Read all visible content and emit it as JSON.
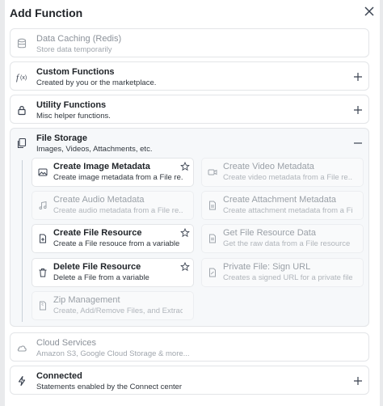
{
  "dialog": {
    "title": "Add Function",
    "close_icon": "close-icon"
  },
  "categories": [
    {
      "name": "Data Caching (Redis)",
      "desc": "Store data temporarily",
      "icon": "database-icon",
      "disabled": true
    },
    {
      "name": "Custom Functions",
      "desc": "Created by you or the marketplace.",
      "icon": "function-icon",
      "action": "plus-icon"
    },
    {
      "name": "Utility Functions",
      "desc": "Misc helper functions.",
      "icon": "lock-icon",
      "action": "plus-icon"
    },
    {
      "name": "File Storage",
      "desc": "Images, Videos, Attachments, etc.",
      "icon": "files-icon",
      "action": "minus-icon",
      "expanded": true
    },
    {
      "name": "Cloud Services",
      "desc": "Amazon S3, Google Cloud Storage & more...",
      "icon": "cloud-icon",
      "disabled": true
    },
    {
      "name": "Connected",
      "desc": "Statements enabled by the Connect center",
      "icon": "bolt-icon",
      "action": "plus-icon"
    }
  ],
  "file_storage_items": [
    {
      "name": "Create Image Metadata",
      "desc": "Create image metadata from a File re...",
      "icon": "image-icon",
      "enabled": true,
      "star": true
    },
    {
      "name": "Create Video Metadata",
      "desc": "Create video metadata from a File re...",
      "icon": "video-icon",
      "enabled": false
    },
    {
      "name": "Create Audio Metadata",
      "desc": "Create audio metadata from a File re...",
      "icon": "music-icon",
      "enabled": false
    },
    {
      "name": "Create Attachment Metadata",
      "desc": "Create attachment metadata from a File re...",
      "icon": "document-icon",
      "enabled": false
    },
    {
      "name": "Create File Resource",
      "desc": "Create a File resouce from a variable",
      "icon": "file-plus-icon",
      "enabled": true,
      "star": true
    },
    {
      "name": "Get File Resource Data",
      "desc": "Get the raw data from a File resource",
      "icon": "file-icon",
      "enabled": false
    },
    {
      "name": "Delete File Resource",
      "desc": "Delete a File from a variable",
      "icon": "trash-icon",
      "enabled": true,
      "star": true
    },
    {
      "name": "Private File: Sign URL",
      "desc": "Creates a signed URL for a private file",
      "icon": "file-link-icon",
      "enabled": false
    },
    {
      "name": "Zip Management",
      "desc": "Create, Add/Remove Files, and Extract",
      "icon": "zip-icon",
      "enabled": false
    }
  ],
  "colors": {
    "text": "#1f2328",
    "muted": "#8b9199",
    "border": "#e3e5e8",
    "icon": "#3a4250"
  }
}
